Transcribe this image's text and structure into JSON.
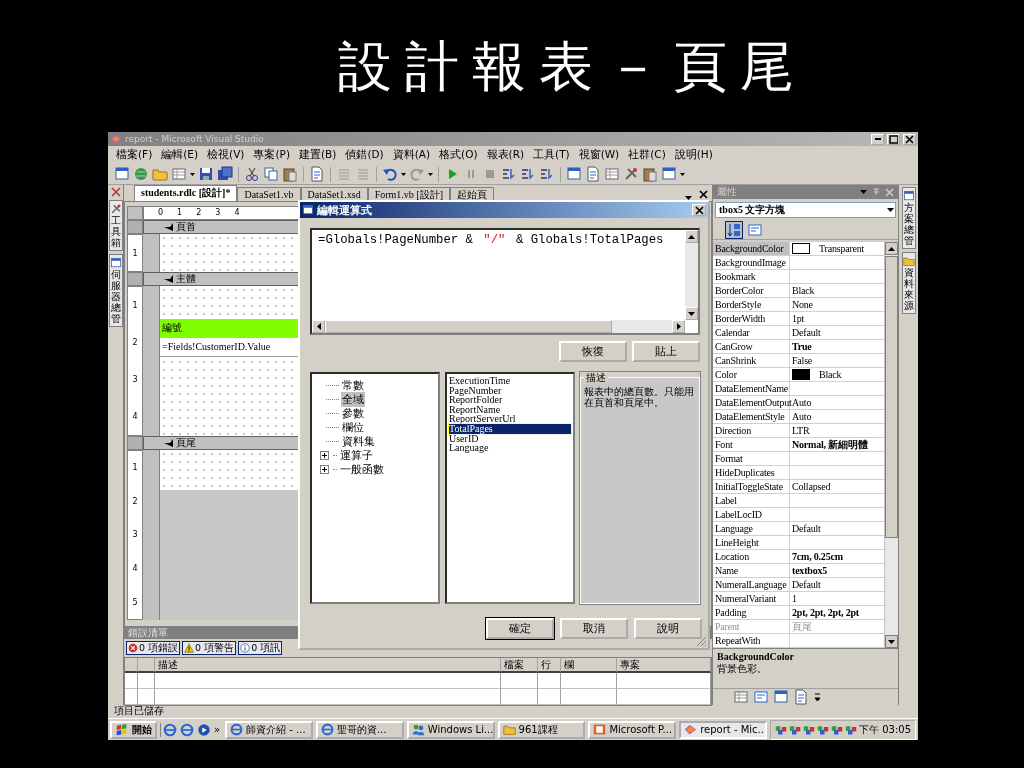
{
  "slide_title": "設計報表－頁尾",
  "window": {
    "title": "report - Microsoft Visual Studio"
  },
  "menu": [
    "檔案(F)",
    "編輯(E)",
    "檢視(V)",
    "專案(P)",
    "建置(B)",
    "偵錯(D)",
    "資料(A)",
    "格式(O)",
    "報表(R)",
    "工具(T)",
    "視窗(W)",
    "社群(C)",
    "說明(H)"
  ],
  "document_tabs": [
    {
      "label": "students.rdlc [設計]*",
      "selected": true
    },
    {
      "label": "DataSet1.vb",
      "selected": false
    },
    {
      "label": "DataSet1.xsd",
      "selected": false
    },
    {
      "label": "Form1.vb [設計]",
      "selected": false
    },
    {
      "label": "起始頁",
      "selected": false
    }
  ],
  "left_dock_tabs": [
    "工具箱",
    "伺服器總管"
  ],
  "right_dock_tabs": [
    "方案總管",
    "資料來源"
  ],
  "designer": {
    "ruler": [
      "0",
      "1",
      "2",
      "3",
      "4"
    ],
    "sections": [
      {
        "label": "頁首",
        "ruler": [
          "1"
        ]
      },
      {
        "label": "主體",
        "ruler": [
          "1",
          "2",
          "3",
          "4"
        ],
        "textboxes": [
          {
            "text": "編號",
            "kind": "header"
          },
          {
            "text": "=Fields!CustomerID.Value",
            "kind": "field"
          }
        ]
      },
      {
        "label": "頁尾",
        "ruler": [
          "1",
          "2",
          "3",
          "4",
          "5"
        ]
      }
    ]
  },
  "error_list": {
    "title": "錯誤清單",
    "filters": [
      {
        "label": "0 項錯誤",
        "kind": "error"
      },
      {
        "label": "0 項警告",
        "kind": "warning"
      },
      {
        "label": "0 項訊",
        "kind": "info"
      }
    ],
    "columns": [
      "描述",
      "檔案",
      "行",
      "欄",
      "專案"
    ]
  },
  "properties": {
    "title": "屬性",
    "object": "tbox5 文字方塊",
    "rows": [
      {
        "name": "BackgroundColor",
        "value": "Transparent",
        "color": "#ffffff",
        "selected": true,
        "modified": false,
        "disabled": false
      },
      {
        "name": "BackgroundImage",
        "selected": false,
        "disabled": false
      },
      {
        "name": "Bookmark",
        "selected": false,
        "disabled": false
      },
      {
        "name": "BorderColor",
        "value": "Black",
        "selected": false,
        "modified": false,
        "disabled": false
      },
      {
        "name": "BorderStyle",
        "value": "None",
        "selected": false,
        "modified": false,
        "disabled": false
      },
      {
        "name": "BorderWidth",
        "value": "1pt",
        "selected": false,
        "modified": false,
        "disabled": false
      },
      {
        "name": "Calendar",
        "value": "Default",
        "selected": false,
        "modified": false,
        "disabled": false
      },
      {
        "name": "CanGrow",
        "value": "True",
        "selected": false,
        "modified": true,
        "disabled": false
      },
      {
        "name": "CanShrink",
        "value": "False",
        "selected": false,
        "modified": false,
        "disabled": false
      },
      {
        "name": "Color",
        "value": "Black",
        "color": "#000000",
        "selected": false,
        "modified": false,
        "disabled": false
      },
      {
        "name": "DataElementName",
        "selected": false,
        "disabled": false
      },
      {
        "name": "DataElementOutput",
        "value": "Auto",
        "selected": false,
        "modified": false,
        "disabled": false
      },
      {
        "name": "DataElementStyle",
        "value": "Auto",
        "selected": false,
        "modified": false,
        "disabled": false
      },
      {
        "name": "Direction",
        "value": "LTR",
        "selected": false,
        "modified": false,
        "disabled": false
      },
      {
        "name": "Font",
        "value": "Normal, 新細明體",
        "selected": false,
        "modified": true,
        "disabled": false
      },
      {
        "name": "Format",
        "selected": false,
        "disabled": false
      },
      {
        "name": "HideDuplicates",
        "selected": false,
        "disabled": false
      },
      {
        "name": "InitialToggleState",
        "value": "Collapsed",
        "selected": false,
        "modified": false,
        "disabled": false
      },
      {
        "name": "Label",
        "selected": false,
        "disabled": false
      },
      {
        "name": "LabelLocID",
        "selected": false,
        "disabled": false
      },
      {
        "name": "Language",
        "value": "Default",
        "selected": false,
        "modified": false,
        "disabled": false
      },
      {
        "name": "LineHeight",
        "selected": false,
        "disabled": false
      },
      {
        "name": "Location",
        "value": "7cm, 0.25cm",
        "selected": false,
        "modified": true,
        "disabled": false
      },
      {
        "name": "Name",
        "value": "textbox5",
        "selected": false,
        "modified": true,
        "disabled": false
      },
      {
        "name": "NumeralLanguage",
        "value": "Default",
        "selected": false,
        "modified": false,
        "disabled": false
      },
      {
        "name": "NumeralVariant",
        "value": "1",
        "selected": false,
        "modified": false,
        "disabled": false
      },
      {
        "name": "Padding",
        "value": "2pt, 2pt, 2pt, 2pt",
        "selected": false,
        "modified": true,
        "disabled": false
      },
      {
        "name": "Parent",
        "value": "頁尾",
        "selected": false,
        "modified": false,
        "disabled": true
      },
      {
        "name": "RepeatWith",
        "selected": false,
        "disabled": false
      }
    ],
    "description": {
      "name": "BackgroundColor",
      "text": "背景色彩。"
    }
  },
  "dialog": {
    "title": "編輯運算式",
    "expression": [
      {
        "text": "=Globals!PageNumber & ",
        "kind": "code"
      },
      {
        "text": "\"/\"",
        "kind": "string"
      },
      {
        "text": " & Globals!TotalPages",
        "kind": "code"
      }
    ],
    "edit_buttons": [
      "恢復",
      "貼上"
    ],
    "categories": [
      {
        "label": "常數",
        "kind": "leaf",
        "selected": false
      },
      {
        "label": "全域",
        "kind": "leaf",
        "selected": true
      },
      {
        "label": "參數",
        "kind": "leaf",
        "selected": false
      },
      {
        "label": "欄位",
        "kind": "leaf",
        "selected": false
      },
      {
        "label": "資料集",
        "kind": "leaf",
        "selected": false
      },
      {
        "label": "運算子",
        "kind": "folder",
        "selected": false
      },
      {
        "label": "一般函數",
        "kind": "folder",
        "selected": false
      }
    ],
    "members": [
      {
        "label": "ExecutionTime",
        "selected": false
      },
      {
        "label": "PageNumber",
        "selected": false
      },
      {
        "label": "ReportFolder",
        "selected": false
      },
      {
        "label": "ReportName",
        "selected": false
      },
      {
        "label": "ReportServerUrl",
        "selected": false
      },
      {
        "label": "TotalPages",
        "selected": true
      },
      {
        "label": "UserID",
        "selected": false
      },
      {
        "label": "Language",
        "selected": false
      }
    ],
    "description": {
      "title": "描述",
      "text": "報表中的總頁數。只能用在頁首和頁尾中。"
    },
    "buttons": [
      {
        "label": "確定",
        "default": true
      },
      {
        "label": "取消",
        "default": false
      },
      {
        "label": "說明",
        "default": false
      }
    ]
  },
  "status_bar": "項目已儲存",
  "taskbar": {
    "start": "開始",
    "more": "»",
    "tasks": [
      {
        "label": "師資介紹 - ...",
        "kind": "browser",
        "selected": false
      },
      {
        "label": "聖哥的資...",
        "kind": "browser",
        "selected": false
      },
      {
        "label": "Windows Li...",
        "kind": "messenger",
        "selected": false
      },
      {
        "label": "961課程",
        "kind": "folder",
        "selected": false
      },
      {
        "label": "Microsoft P...",
        "kind": "slides",
        "selected": false
      },
      {
        "label": "report - Mic...",
        "kind": "studio",
        "selected": true
      }
    ],
    "clock": "下午 03:05"
  }
}
